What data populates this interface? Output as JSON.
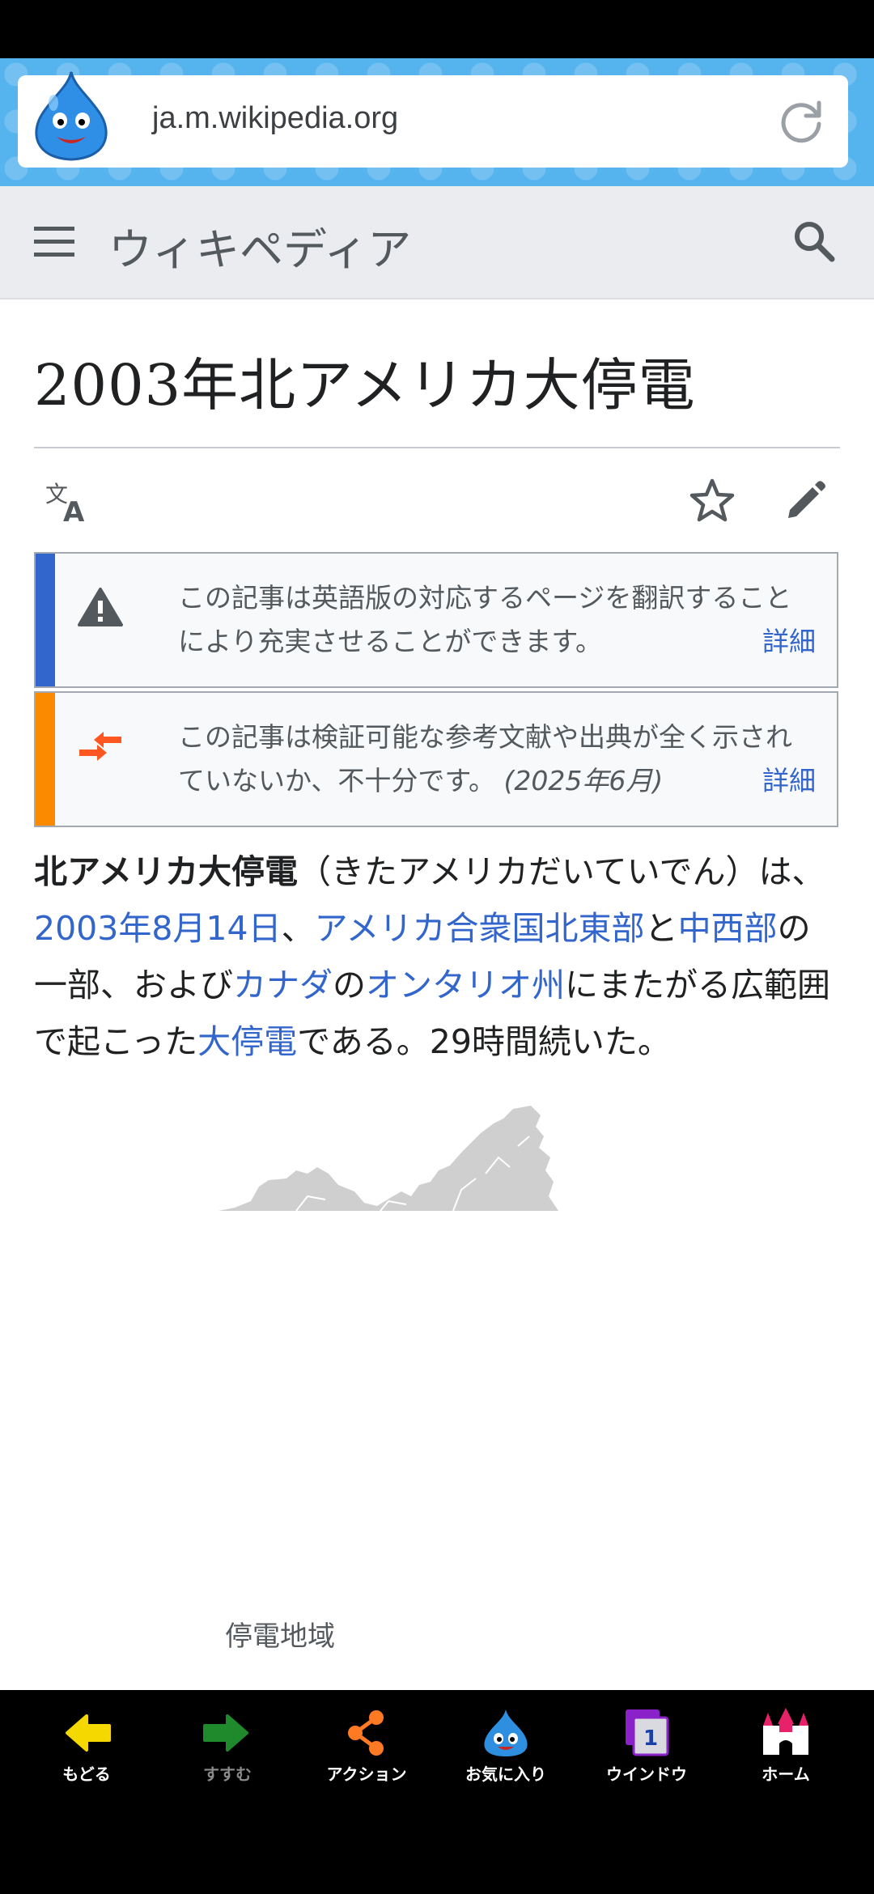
{
  "browser": {
    "url": "ja.m.wikipedia.org"
  },
  "wiki": {
    "logo_text": "ウィキペディア",
    "page_title": "2003年北アメリカ大停電"
  },
  "notices": [
    {
      "text": "この記事は英語版の対応するページを翻訳することにより充実させることができます。",
      "more": "詳細",
      "accent": "#3366cc"
    },
    {
      "text": "この記事は検証可能な参考文献や出典が全く示されていないか、不十分です。",
      "date": "(2025年6月)",
      "more": "詳細",
      "accent": "#fc8a00"
    }
  ],
  "lead": {
    "bold": "北アメリカ大停電",
    "reading": "（きたアメリカだいていでん）",
    "p1": "は、",
    "link_date": "2003年8月14日",
    "p2": "、",
    "link_us_ne": "アメリカ合衆国北東部",
    "p3": "と",
    "link_midwest": "中西部",
    "p4": "の一部、および",
    "link_canada": "カナダ",
    "p5": "の",
    "link_ontario": "オンタリオ州",
    "p6": "にまたがる広範囲で起こった",
    "link_blackout": "大停電",
    "p7": "である。29時間続いた。"
  },
  "figure": {
    "caption": "停電地域"
  },
  "bottom_nav": [
    {
      "label": "もどる",
      "icon": "back-arrow-icon",
      "color": "#f5d800"
    },
    {
      "label": "すすむ",
      "icon": "forward-arrow-icon",
      "color": "#1f8a2c"
    },
    {
      "label": "アクション",
      "icon": "share-icon",
      "color": "#ff7a22"
    },
    {
      "label": "お気に入り",
      "icon": "slime-icon",
      "color": "#2e8fe0"
    },
    {
      "label": "ウインドウ",
      "icon": "window-icon",
      "window_count": "1",
      "color": "#8b22c9"
    },
    {
      "label": "ホーム",
      "icon": "castle-icon",
      "color": "#e8226a"
    }
  ]
}
